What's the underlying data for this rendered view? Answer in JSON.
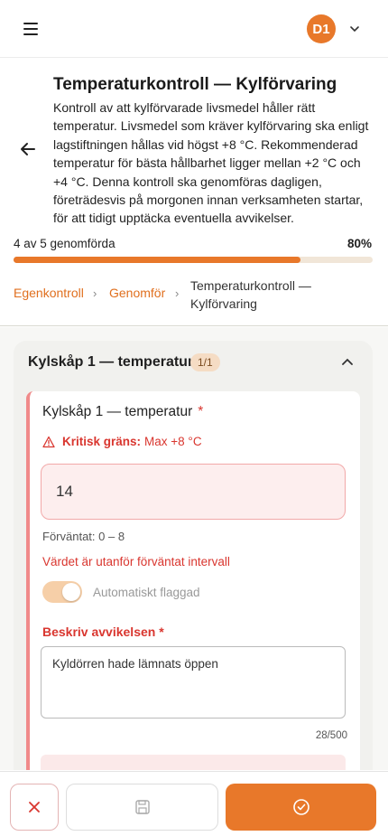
{
  "user": {
    "initials": "D1"
  },
  "header": {
    "title": "Temperaturkontroll — Kylförvaring",
    "description": "Kontroll av att kylförvarade livsmedel håller rätt temperatur. Livsmedel som kräver kylförvaring ska enligt lagstiftningen hållas vid högst +8 °C. Rekommenderad temperatur för bästa hållbarhet ligger mellan +2 °C och +4 °C. Denna kontroll ska genomföras dagligen, företrädesvis på morgonen innan verksamheten startar, för att tidigt upptäcka eventuella avvikelser."
  },
  "progress": {
    "label": "4 av 5 genomförda",
    "percent_label": "80%",
    "fraction": 0.8
  },
  "breadcrumb": {
    "items": [
      "Egenkontroll",
      "Genomför"
    ],
    "separator": "›",
    "current": "Temperaturkontroll — Kylförvaring"
  },
  "section": {
    "title": "Kylskåp 1 — temperatur",
    "badge": "1/1"
  },
  "question": {
    "title": "Kylskåp 1 — temperatur",
    "required_mark": "*",
    "critical_label": "Kritisk gräns:",
    "critical_value": "Max +8 °C",
    "value": "14",
    "expected": "Förväntat: 0 – 8",
    "out_of_range": "Värdet är utanför förväntat intervall",
    "auto_flag_label": "Automatiskt flaggad",
    "deviation_label": "Beskriv avvikelsen *",
    "deviation_text": "Kyldörren hade lämnats öppen",
    "counter": "28/500"
  },
  "colors": {
    "accent": "#e8782a",
    "danger": "#d9362f"
  },
  "icons": {
    "menu": "menu-icon",
    "chevron": "chevron-down-icon",
    "back": "arrow-left-icon",
    "collapse": "chevron-up-icon",
    "warning": "warning-icon",
    "cancel": "close-icon",
    "save": "save-icon",
    "submit": "check-circle-icon"
  }
}
